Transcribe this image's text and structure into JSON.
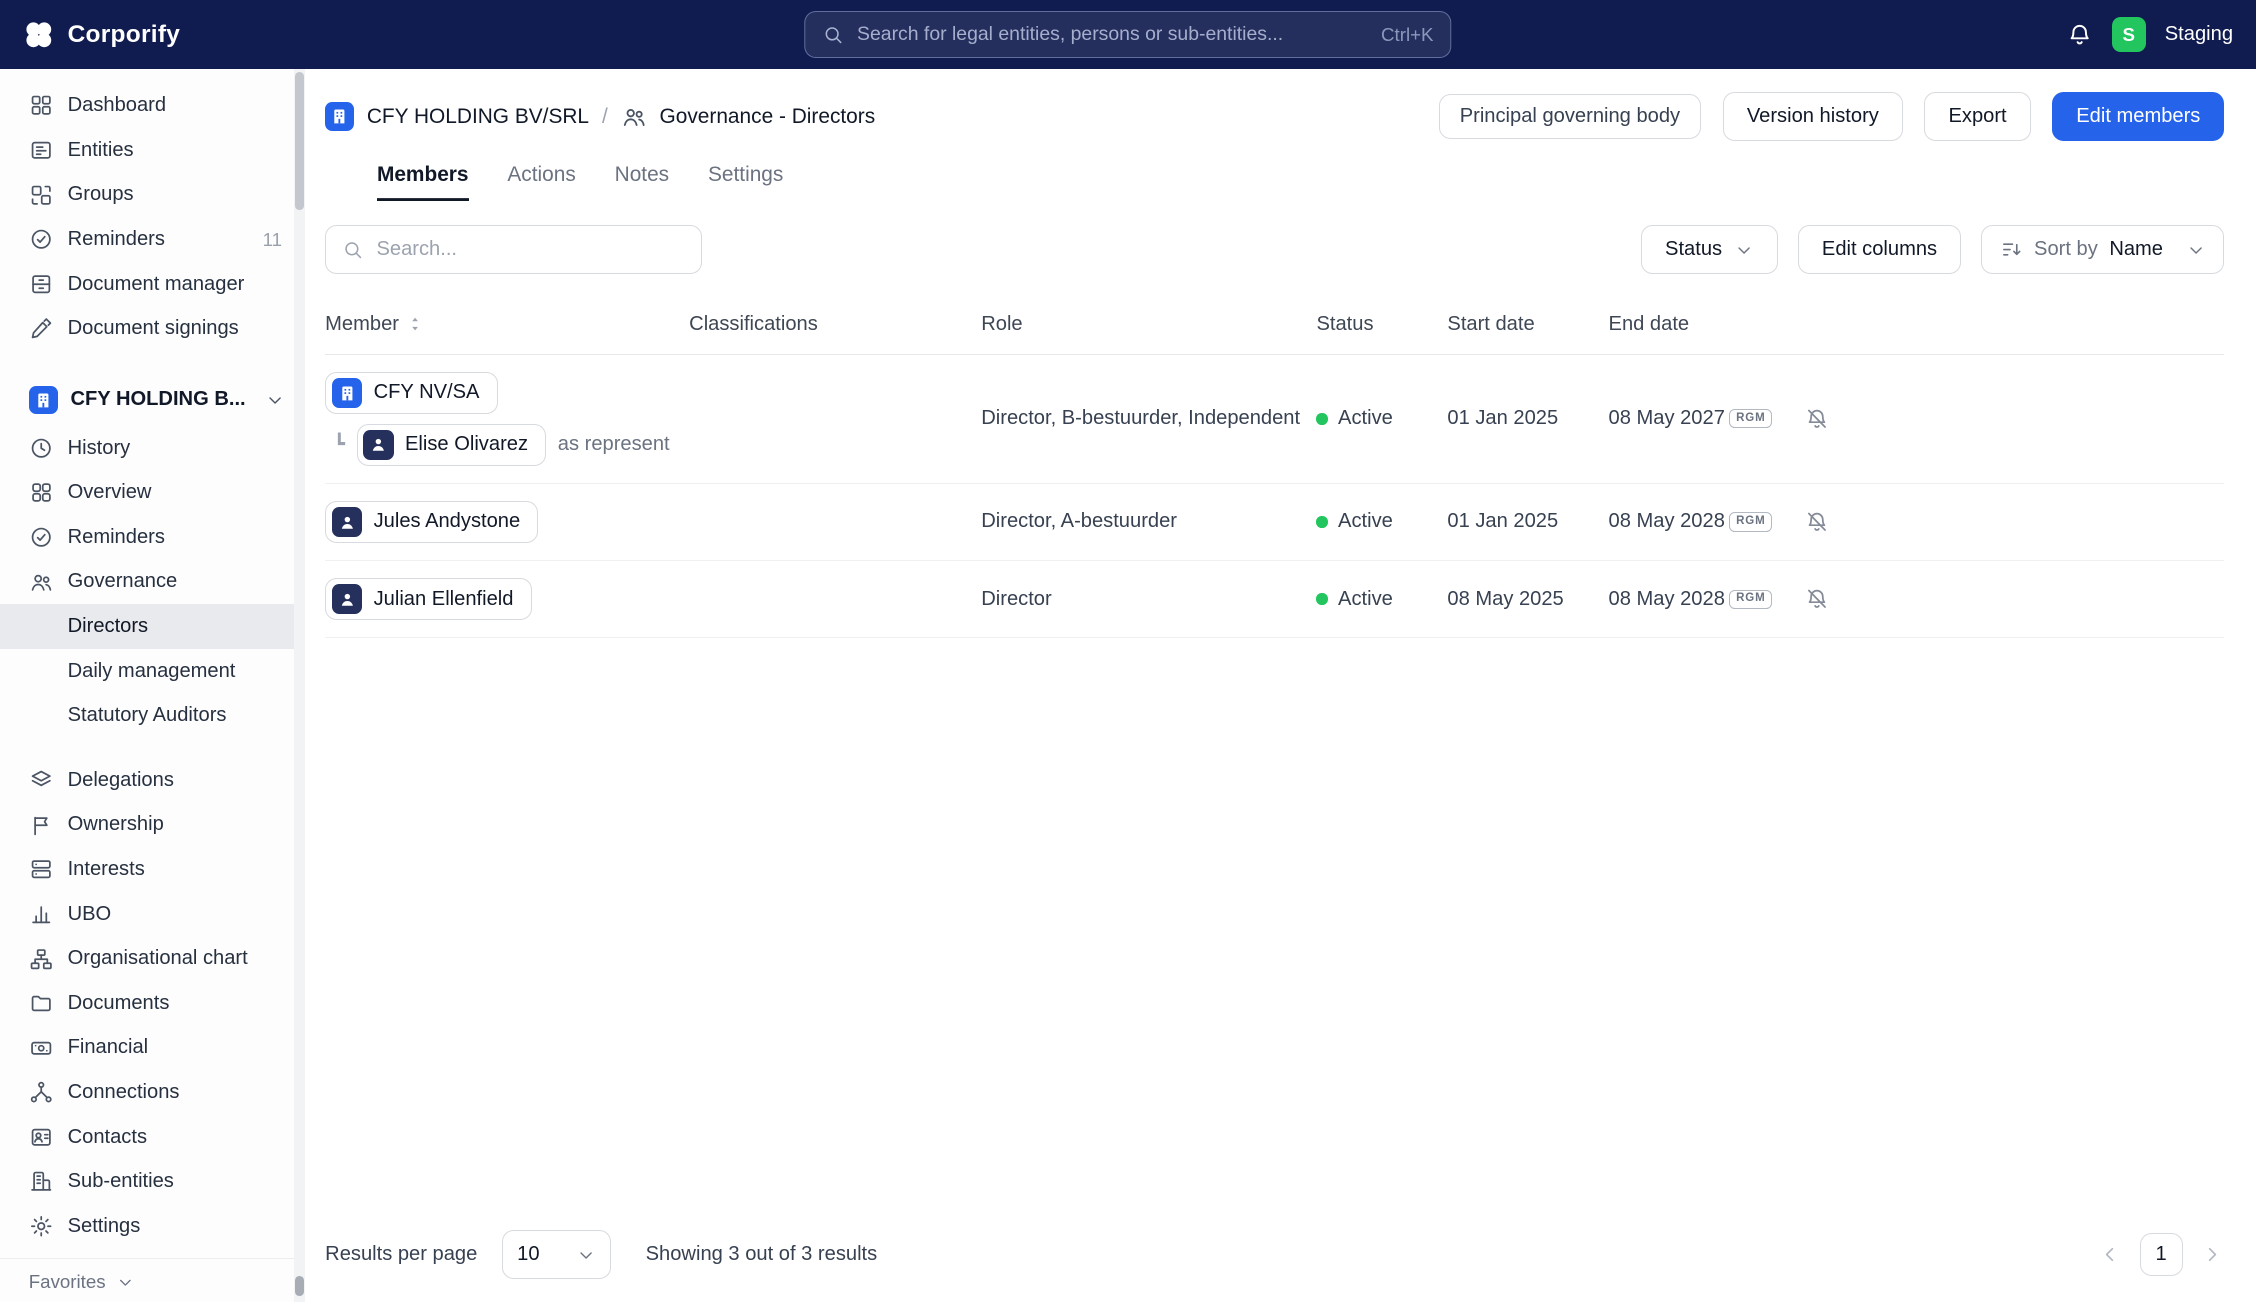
{
  "topbar": {
    "brand": "Corporify",
    "search_placeholder": "Search for legal entities, persons or sub-entities...",
    "search_shortcut": "Ctrl+K",
    "avatar_initial": "S",
    "environment": "Staging"
  },
  "sidebar": {
    "top_items": [
      "Dashboard",
      "Entities",
      "Groups",
      "Reminders",
      "Document manager",
      "Document signings"
    ],
    "reminders_badge": "11",
    "entity_label": "CFY HOLDING B...",
    "entity_items": [
      "History",
      "Overview",
      "Reminders",
      "Governance"
    ],
    "governance_children": [
      "Directors",
      "Daily management",
      "Statutory Auditors"
    ],
    "entity_items_after": [
      "Delegations",
      "Ownership",
      "Interests",
      "UBO",
      "Organisational chart",
      "Documents",
      "Financial",
      "Connections",
      "Contacts",
      "Sub-entities",
      "Settings"
    ],
    "favorites_label": "Favorites"
  },
  "header": {
    "entity_name": "CFY HOLDING BV/SRL",
    "separator": "/",
    "page_title": "Governance - Directors",
    "principal_label": "Principal governing body",
    "version_history_label": "Version history",
    "export_label": "Export",
    "edit_members_label": "Edit members"
  },
  "tabs": [
    "Members",
    "Actions",
    "Notes",
    "Settings"
  ],
  "toolbar": {
    "search_placeholder": "Search...",
    "status_label": "Status",
    "edit_columns_label": "Edit columns",
    "sort_by_label": "Sort by",
    "sort_value": "Name"
  },
  "table": {
    "columns": [
      "Member",
      "Classifications",
      "Role",
      "Status",
      "Start date",
      "End date"
    ],
    "rows": [
      {
        "member": "CFY NV/SA",
        "member_type": "entity",
        "sub_member": "Elise Olivarez",
        "sub_note": "as represent",
        "classifications": "",
        "role": "Director, B-bestuurder, Independent",
        "status": "Active",
        "start_date": "01 Jan 2025",
        "end_date": "08 May 2027",
        "badge": "RGM"
      },
      {
        "member": "Jules Andystone",
        "member_type": "person",
        "classifications": "",
        "role": "Director, A-bestuurder",
        "status": "Active",
        "start_date": "01 Jan 2025",
        "end_date": "08 May 2028",
        "badge": "RGM"
      },
      {
        "member": "Julian Ellenfield",
        "member_type": "person",
        "classifications": "",
        "role": "Director",
        "status": "Active",
        "start_date": "08 May 2025",
        "end_date": "08 May 2028",
        "badge": "RGM"
      }
    ]
  },
  "footer": {
    "results_per_page_label": "Results per page",
    "per_page_value": "10",
    "showing_text": "Showing 3 out of 3 results",
    "page_number": "1"
  },
  "colors": {
    "brand_navy": "#101b4f",
    "primary_blue": "#2563eb",
    "status_green": "#22c55e"
  }
}
